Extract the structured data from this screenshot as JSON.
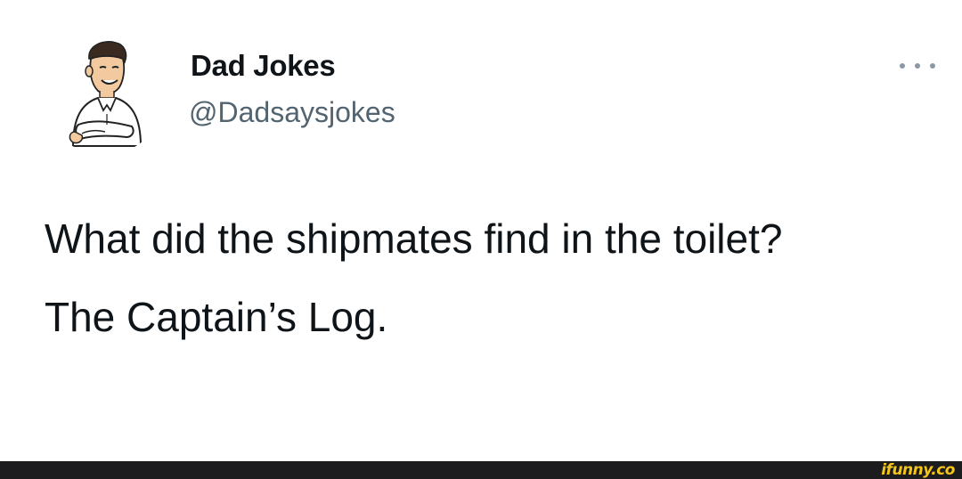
{
  "tweet": {
    "display_name": "Dad Jokes",
    "handle": "@Dadsaysjokes",
    "text_line_1": "What did the shipmates find in the toilet?",
    "text_line_2": "The Captain’s Log.",
    "avatar_icon": "cartoon-man-arms-crossed",
    "more_icon": "more-horizontal-icon"
  },
  "footer": {
    "watermark": "ifunny.co",
    "bar_color": "#1c1c1e",
    "watermark_color": "#f5c518"
  },
  "colors": {
    "text_primary": "#0f1419",
    "text_secondary": "#536471"
  }
}
